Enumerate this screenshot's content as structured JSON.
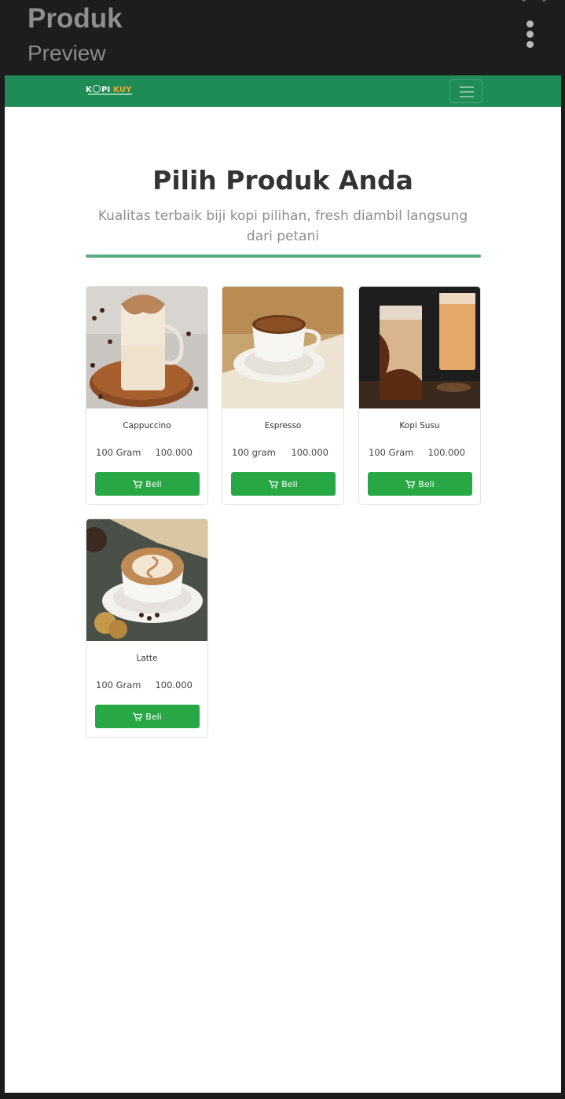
{
  "appbar": {
    "title": "Produk",
    "subtitle": "Preview",
    "menu_icon": "kebab-menu-icon"
  },
  "navbar": {
    "logo": {
      "part1": "K",
      "part2": "PI",
      "part3": "KUY",
      "accent": "#f0a830"
    },
    "menu_icon": "hamburger-icon",
    "color": "#1f8c55"
  },
  "hero": {
    "title": "Pilih Produk Anda",
    "subtitle": "Kualitas terbaik biji kopi pilihan, fresh diambil langsung dari petani"
  },
  "products": [
    {
      "name": "Cappuccino",
      "weight": "100 Gram",
      "price": "100.000",
      "button": "Beli"
    },
    {
      "name": "Espresso",
      "weight": "100 gram",
      "price": "100.000",
      "button": "Beli"
    },
    {
      "name": "Kopi Susu",
      "weight": "100 Gram",
      "price": "100.000",
      "button": "Beli"
    },
    {
      "name": "Latte",
      "weight": "100 Gram",
      "price": "100.000",
      "button": "Beli"
    }
  ],
  "colors": {
    "buy_button": "#28a745",
    "divider": "#5aab7f"
  }
}
